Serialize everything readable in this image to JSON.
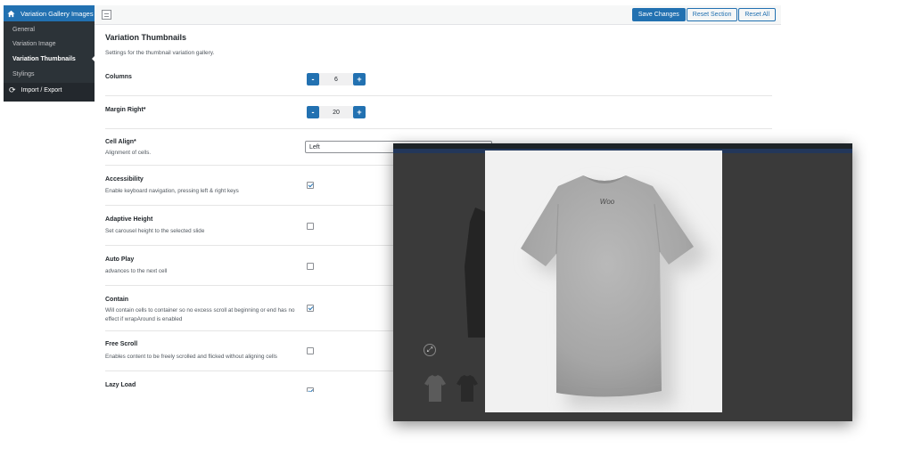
{
  "sidebar": {
    "header": "Variation Gallery Images",
    "items": [
      {
        "label": "General"
      },
      {
        "label": "Variation Image"
      },
      {
        "label": "Variation Thumbnails"
      },
      {
        "label": "Stylings"
      }
    ],
    "import_export": "Import / Export"
  },
  "toolbar": {
    "save_label": "Save Changes",
    "reset_section_label": "Reset Section",
    "reset_all_label": "Reset All"
  },
  "content": {
    "title": "Variation Thumbnails",
    "description": "Settings for the thumbnail variation gallery.",
    "rows": [
      {
        "label": "Columns",
        "value": "6"
      },
      {
        "label": "Margin Right*",
        "value": "20"
      },
      {
        "label": "Cell Align*",
        "sub": "Alignment of cells.",
        "value": "Left"
      },
      {
        "label": "Accessibility",
        "sub": "Enable keyboard navigation, pressing left & right keys",
        "checked": true
      },
      {
        "label": "Adaptive Height",
        "sub": "Set carousel height to the selected slide",
        "checked": false
      },
      {
        "label": "Auto Play",
        "sub": "advances to the next cell",
        "checked": false
      },
      {
        "label": "Contain",
        "sub": "Will contain cells to container so no excess scroll at beginning or end has no effect if wrapAround is enabled",
        "checked": true
      },
      {
        "label": "Free Scroll",
        "sub": "Enables content to be freely scrolled and flicked without aligning cells",
        "checked": false
      },
      {
        "label": "Lazy Load",
        "checked": true
      }
    ],
    "stepper_minus": "-",
    "stepper_plus": "+"
  },
  "lightbox": {
    "logo_text": "Woo"
  },
  "colors": {
    "accent": "#2271b1",
    "sidebar_bg": "#23282d",
    "lightbox_bg": "#3a3a3a"
  },
  "icons": {
    "home": "home-icon",
    "refresh": "refresh-icon",
    "expand": "expand-icon"
  }
}
